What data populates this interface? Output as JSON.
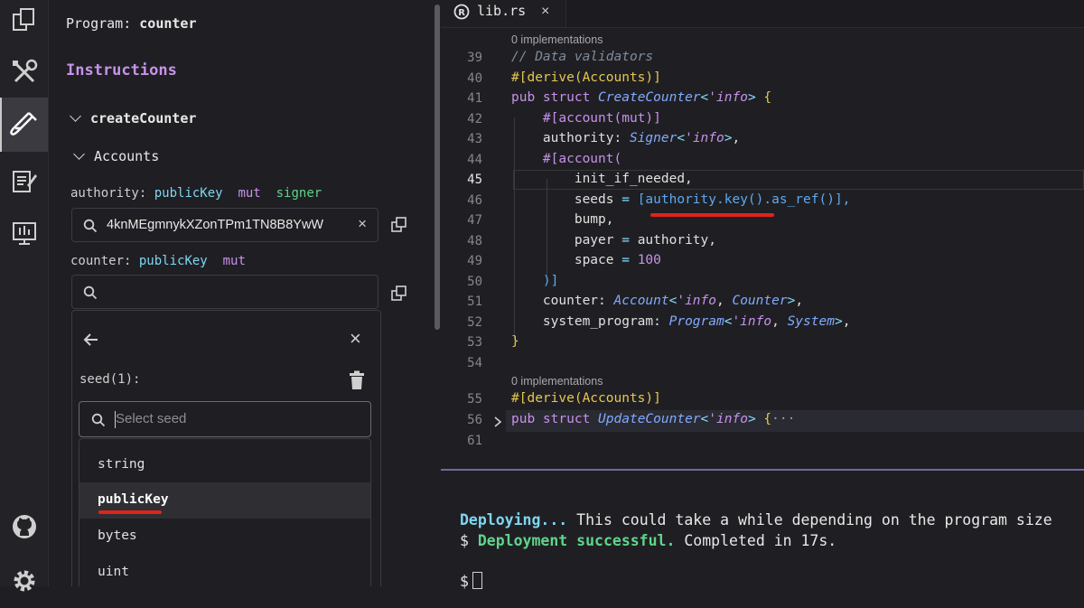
{
  "sidebar": {
    "program_prefix": "Program:",
    "program_name": "counter",
    "instructions_title": "Instructions",
    "instruction": "createCounter",
    "accounts_label": "Accounts",
    "authority": {
      "name": "authority:",
      "type": "publicKey",
      "flag_mut": "mut",
      "flag_signer": "signer",
      "value": "4knMEgmnykXZonTPm1TN8B8YwW"
    },
    "counter": {
      "name": "counter:",
      "type": "publicKey",
      "flag_mut": "mut",
      "value": ""
    },
    "seed_label": "seed(1):",
    "seed_placeholder": "Select seed",
    "seed_options": [
      "string",
      "publicKey",
      "bytes",
      "uint"
    ],
    "highlighted_option": "publicKey"
  },
  "tab": {
    "file_name": "lib.rs",
    "close": "×"
  },
  "editor": {
    "lens_text": "0 implementations",
    "line_numbers": [
      "39",
      "40",
      "41",
      "42",
      "43",
      "44",
      "45",
      "46",
      "47",
      "48",
      "49",
      "50",
      "51",
      "52",
      "53",
      "54",
      "55",
      "56",
      "61"
    ],
    "lines": {
      "l39": "// Data validators",
      "l40_attr": "#[derive(Accounts)]",
      "l41_pub": "pub struct",
      "l41_name": "CreateCounter",
      "l41_lt": "'info",
      "l42": "#[account(mut)]",
      "l43_field": "authority:",
      "l43_type": "Signer",
      "l44": "#[account(",
      "l45": "init_if_needed,",
      "l46_key": "seeds",
      "l46_val": "[authority.key().as_ref()],",
      "l47": "bump,",
      "l48_key": "payer",
      "l48_val": "authority,",
      "l49_key": "space",
      "l49_val": "100",
      "l50": ")]",
      "l51_field": "counter:",
      "l51_type": "Account",
      "l51_type2": "Counter",
      "l52_field": "system_program:",
      "l52_type": "Program",
      "l52_type2": "System",
      "l53": "}",
      "l55_attr": "#[derive(Accounts)]",
      "l56_name": "UpdateCounter"
    }
  },
  "terminal": {
    "deploying": "Deploying...",
    "deploying_rest": " This could take a while depending on the program size",
    "prompt": "$",
    "success": "Deployment successful.",
    "completed": " Completed in 17s."
  }
}
